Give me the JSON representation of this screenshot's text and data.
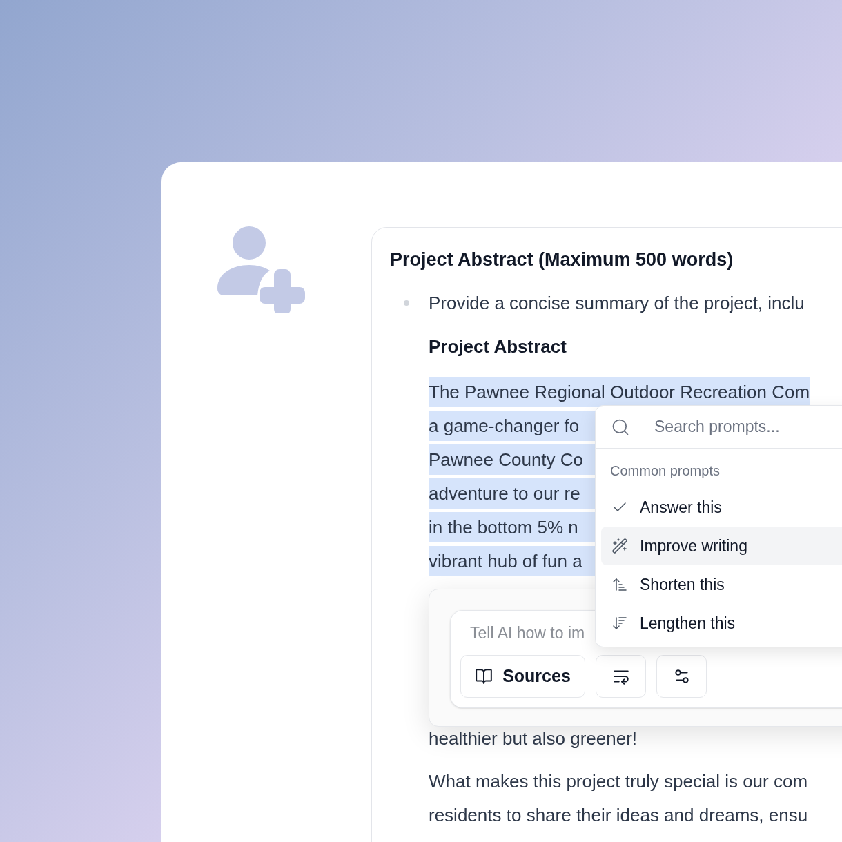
{
  "document": {
    "title": "Project Abstract (Maximum 500 words)",
    "bullets": [
      "Provide a concise summary of the project, inclu"
    ],
    "section_heading": "Project Abstract",
    "selected_lines": [
      "The Pawnee Regional Outdoor Recreation Com",
      "a game-changer fo",
      "Pawnee County Co",
      "adventure to our re",
      "in the bottom 5% n",
      "vibrant hub of fun a"
    ],
    "paragraph_end": "healthier but also greener!",
    "next_paragraph_lines": [
      "What makes this project truly special is our com",
      "residents to share their ideas and dreams, ensu"
    ]
  },
  "ai_prompt": {
    "placeholder": "Tell AI how to im",
    "buttons": [
      {
        "kind": "sources",
        "label": "Sources"
      },
      {
        "kind": "wrap"
      },
      {
        "kind": "settings"
      }
    ]
  },
  "prompt_menu": {
    "search_placeholder": "Search prompts...",
    "section_label": "Common prompts",
    "items": [
      {
        "kind": "check",
        "label": "Answer this",
        "selected": false
      },
      {
        "kind": "wand",
        "label": "Improve writing",
        "selected": true
      },
      {
        "kind": "shorten",
        "label": "Shorten this",
        "selected": false
      },
      {
        "kind": "lengthen",
        "label": "Lengthen this",
        "selected": false
      }
    ]
  }
}
